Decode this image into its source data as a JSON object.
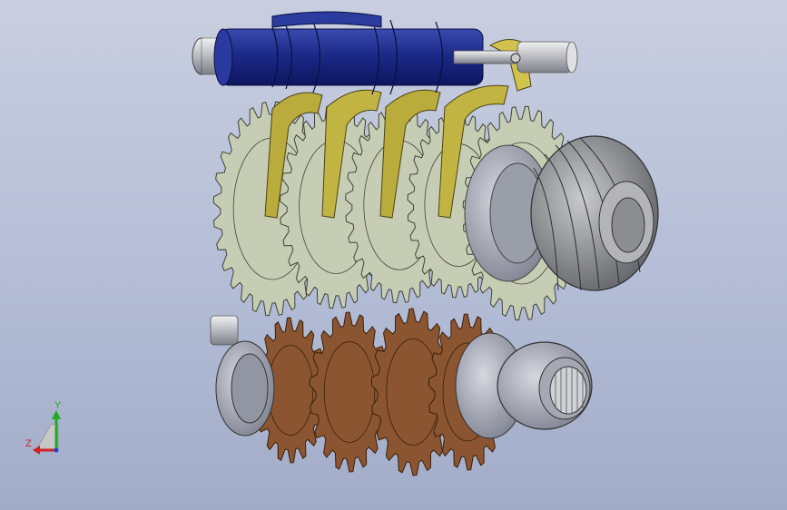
{
  "viewport": {
    "background_top": "#c9cfe0",
    "background_bottom": "#a2acc8"
  },
  "model": {
    "components": [
      {
        "name": "shift-drum",
        "color": "#1c2a88"
      },
      {
        "name": "shift-forks",
        "color": "#b9ab3c"
      },
      {
        "name": "output-shaft-gears",
        "color": "#c7cdb4"
      },
      {
        "name": "bevel-pinion",
        "color": "#8d8f94"
      },
      {
        "name": "input-shaft-gears",
        "color": "#8a5530"
      },
      {
        "name": "hubs-and-bearings",
        "color": "#a8acb8"
      }
    ]
  },
  "triad": {
    "y_label": "Y",
    "z_label": "Z",
    "x_color": "#cc2222",
    "y_color": "#22aa22",
    "z_color": "#2244cc"
  }
}
